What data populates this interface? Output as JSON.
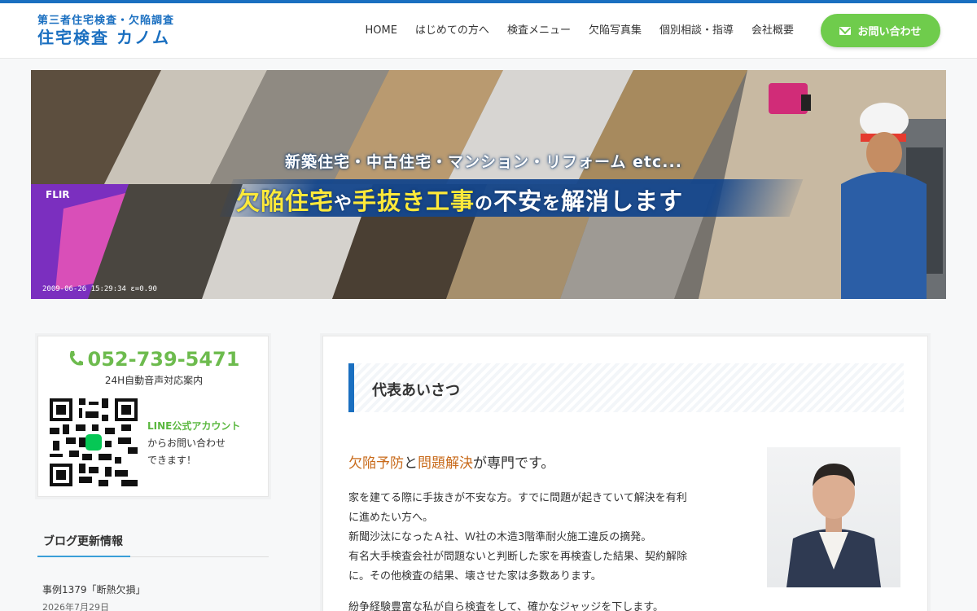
{
  "header": {
    "logo_sub": "第三者住宅検査・欠陥調査",
    "logo_main": "住宅検査 カノム",
    "nav": [
      "HOME",
      "はじめての方へ",
      "検査メニュー",
      "欠陥写真集",
      "個別相談・指導",
      "会社概要"
    ],
    "contact_label": "お問い合わせ",
    "accent_color": "#1a6fc0",
    "contact_color": "#6fcc4c"
  },
  "hero": {
    "subtitle": "新築住宅・中古住宅・マンション・リフォーム etc...",
    "headline_parts": [
      "欠陥住宅",
      "や",
      "手抜き工事",
      "の",
      "不安",
      "を",
      "解消します"
    ],
    "flir_label": "FLIR",
    "timestamp": "2009-06-26 15:29:34 ε=0.90"
  },
  "sidebar": {
    "phone": "052-739-5471",
    "phone_note": "24H自動音声対応案内",
    "line_title": "LINE公式アカウント",
    "line_text1": "からお問い合わせ",
    "line_text2": "できます！",
    "blog_title": "ブログ更新情報",
    "blog_item": "事例1379「断熱欠損」",
    "blog_date": "2026年7月29日"
  },
  "main": {
    "heading": "代表あいさつ",
    "lead_parts": [
      "欠陥予防",
      "と",
      "問題解決",
      "が専門です。"
    ],
    "paragraph_lines": [
      "家を建てる際に手抜きが不安な方。すでに問題が起きていて解決を有利",
      "に進めたい方へ。",
      "新聞沙汰になったＡ社、Ｗ社の木造3階準耐火施工違反の摘発。",
      "有名大手検査会社が問題ないと判断した家を再検査した結果、契約解除",
      "に。その他検査の結果、壊させた家は多数あります。"
    ],
    "paragraph2": "紛争経験豊富な私が自ら検査をして、確かなジャッジを下します。"
  }
}
